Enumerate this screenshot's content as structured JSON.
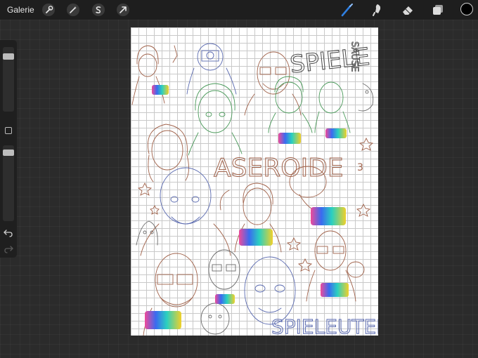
{
  "topbar": {
    "gallery_label": "Galerie",
    "left_tools": [
      {
        "name": "wrench-icon",
        "label": "Actions"
      },
      {
        "name": "magic-wand-icon",
        "label": "Adjustments"
      },
      {
        "name": "selection-s-icon",
        "label": "Selection"
      },
      {
        "name": "transform-arrow-icon",
        "label": "Transform"
      }
    ],
    "right_tools": [
      {
        "name": "brush-icon",
        "label": "Paint",
        "active": true
      },
      {
        "name": "smudge-icon",
        "label": "Smudge",
        "active": false
      },
      {
        "name": "eraser-icon",
        "label": "Erase",
        "active": false
      },
      {
        "name": "layers-icon",
        "label": "Layers",
        "active": false
      }
    ],
    "current_color": "#000000"
  },
  "sidebar": {
    "brush_size_level": 0.8,
    "opacity_level": 0.9,
    "modify_button": "modify-button",
    "undo_icon": "undo-icon",
    "redo_icon": "redo-icon"
  },
  "canvas": {
    "background": "#ffffff",
    "grid_color": "#c9c9c9",
    "lettering_top": "SPIELE",
    "lettering_side": "SAUSE",
    "lettering_middle": "ASEROIDE",
    "lettering_number": "3",
    "lettering_bottom": "SPIELEUTER",
    "sticker_text": "SPIELE"
  },
  "colors": {
    "active_tool": "#2f7fe0",
    "sketch_brown": "#a0624a",
    "sketch_green": "#4a9a5a",
    "sketch_blue": "#5a6ab0",
    "sketch_gray": "#6a6a6a"
  }
}
